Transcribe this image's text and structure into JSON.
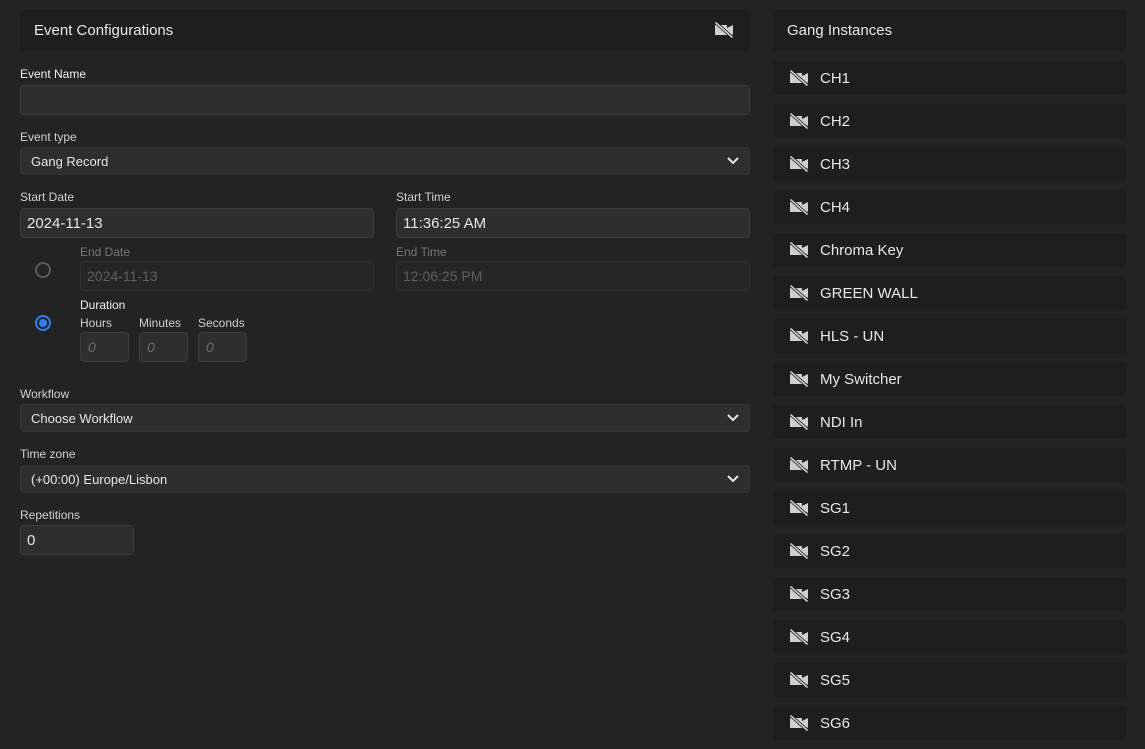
{
  "event_config": {
    "title": "Event Configurations",
    "event_name": {
      "label": "Event Name",
      "value": ""
    },
    "event_type": {
      "label": "Event type",
      "value": "Gang Record"
    },
    "start_date": {
      "label": "Start Date",
      "value": "2024-11-13"
    },
    "start_time": {
      "label": "Start Time",
      "value": "11:36:25 AM"
    },
    "end_date": {
      "label": "End Date",
      "value": "2024-11-13"
    },
    "end_time": {
      "label": "End Time",
      "value": "12:06:25 PM"
    },
    "duration": {
      "label": "Duration",
      "hours_label": "Hours",
      "hours_placeholder": "0",
      "minutes_label": "Minutes",
      "minutes_placeholder": "0",
      "seconds_label": "Seconds",
      "seconds_placeholder": "0"
    },
    "workflow": {
      "label": "Workflow",
      "value": "Choose Workflow"
    },
    "timezone": {
      "label": "Time zone",
      "value": "(+00:00) Europe/Lisbon"
    },
    "repetitions": {
      "label": "Repetitions",
      "value": "0"
    }
  },
  "gang": {
    "title": "Gang Instances",
    "items": [
      {
        "label": "CH1"
      },
      {
        "label": "CH2"
      },
      {
        "label": "CH3"
      },
      {
        "label": "CH4"
      },
      {
        "label": "Chroma Key"
      },
      {
        "label": "GREEN WALL"
      },
      {
        "label": "HLS - UN"
      },
      {
        "label": "My Switcher"
      },
      {
        "label": "NDI In"
      },
      {
        "label": "RTMP - UN"
      },
      {
        "label": "SG1"
      },
      {
        "label": "SG2"
      },
      {
        "label": "SG3"
      },
      {
        "label": "SG4"
      },
      {
        "label": "SG5"
      },
      {
        "label": "SG6"
      }
    ],
    "icon": "video-off-icon"
  }
}
